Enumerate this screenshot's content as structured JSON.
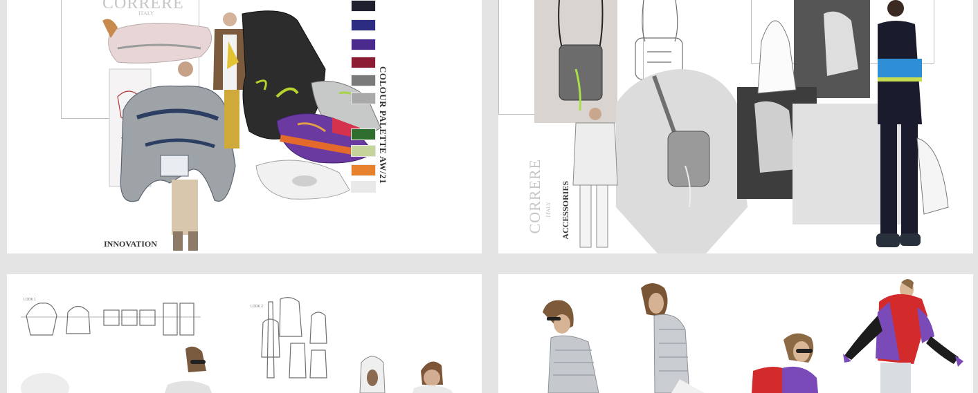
{
  "tile1": {
    "brand": "CORRERE",
    "brand_sub": "ITALY",
    "caption": "INNOVATION",
    "palette_label": "COLOUR PALETTE AW/21",
    "palette_colors": [
      "#1f1f2e",
      "#2c2c82",
      "#4a2a8c",
      "#8c1c33",
      "#7a7a7a",
      "#a9a9a9",
      "#2f6e2f",
      "#c4d49a",
      "#e8812b",
      "#e9e9e9"
    ]
  },
  "tile2": {
    "brand": "CORRERE",
    "brand_sub": "ITALY",
    "caption": "ACCESSORIES"
  },
  "colors": {
    "page_bg": "#e4e4e4",
    "tile_bg": "#ffffff",
    "frame": "#bdbdbd",
    "jacket_red": "#d32b2b",
    "jacket_purple": "#7a4ab8",
    "track_blue": "#2f8fd6"
  }
}
